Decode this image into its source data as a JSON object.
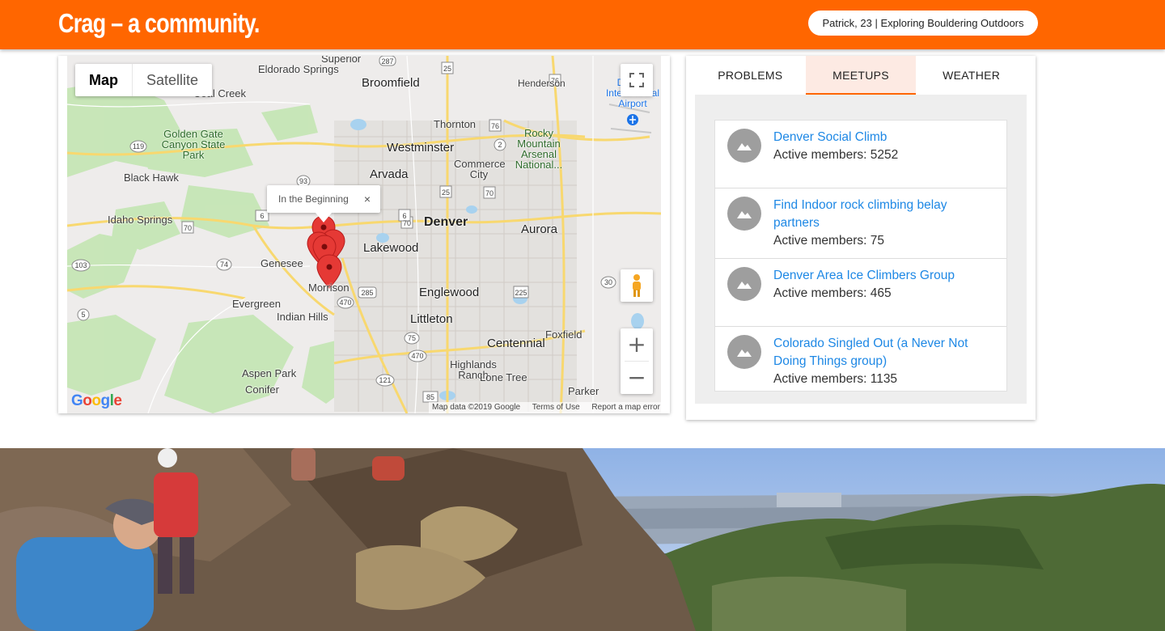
{
  "header": {
    "brand": "Crag – a community.",
    "user_pill": "Patrick, 23 | Exploring Bouldering Outdoors",
    "brand_color": "#ff6600"
  },
  "map": {
    "type_options": [
      "Map",
      "Satellite"
    ],
    "selected_type": "Map",
    "info_window": {
      "text": "In the Beginning",
      "close": "×"
    },
    "place_labels": [
      "Superior",
      "Eldorado Springs",
      "Broomfield",
      "Henderson",
      "Denver International Airport",
      "Coal Creek",
      "Golden Gate Canyon State Park",
      "Thornton",
      "Rocky Mountain Arsenal National...",
      "Westminster",
      "Commerce City",
      "Black Hawk",
      "Arvada",
      "Denver",
      "Idaho Springs",
      "Aurora",
      "Lakewood",
      "Genesee",
      "Morrison",
      "Englewood",
      "Evergreen",
      "Indian Hills",
      "Littleton",
      "Foxfield",
      "Centennial",
      "Highlands Ranch",
      "Lone Tree",
      "Aspen Park",
      "Conifer",
      "Parker"
    ],
    "road_shields": [
      "287",
      "25",
      "76",
      "119",
      "76",
      "2",
      "93",
      "25",
      "70",
      "70",
      "6",
      "70",
      "6",
      "103",
      "74",
      "285",
      "470",
      "225",
      "30",
      "5",
      "75",
      "470",
      "121",
      "85"
    ],
    "attribution": [
      "Map data ©2019 Google",
      "Terms of Use",
      "Report a map error"
    ],
    "logo": "Google",
    "icons": {
      "fullscreen": "fullscreen-icon",
      "pegman": "pegman-icon",
      "zoom_in": "+",
      "zoom_out": "−"
    }
  },
  "sidebar": {
    "tabs": [
      "PROBLEMS",
      "MEETUPS",
      "WEATHER"
    ],
    "active_tab": "MEETUPS",
    "meetups": [
      {
        "name": "Denver Social Climb",
        "members": "Active members: 5252"
      },
      {
        "name": "Find Indoor rock climbing belay partners",
        "members": "Active members: 75"
      },
      {
        "name": "Denver Area Ice Climbers Group",
        "members": "Active members: 465"
      },
      {
        "name": "Colorado Singled Out (a Never Not Doing Things group)",
        "members": "Active members: 1135"
      }
    ]
  },
  "colors": {
    "tab_active_bg": "#fdeae3",
    "link": "#1e88e5",
    "marker": "#e53935"
  }
}
